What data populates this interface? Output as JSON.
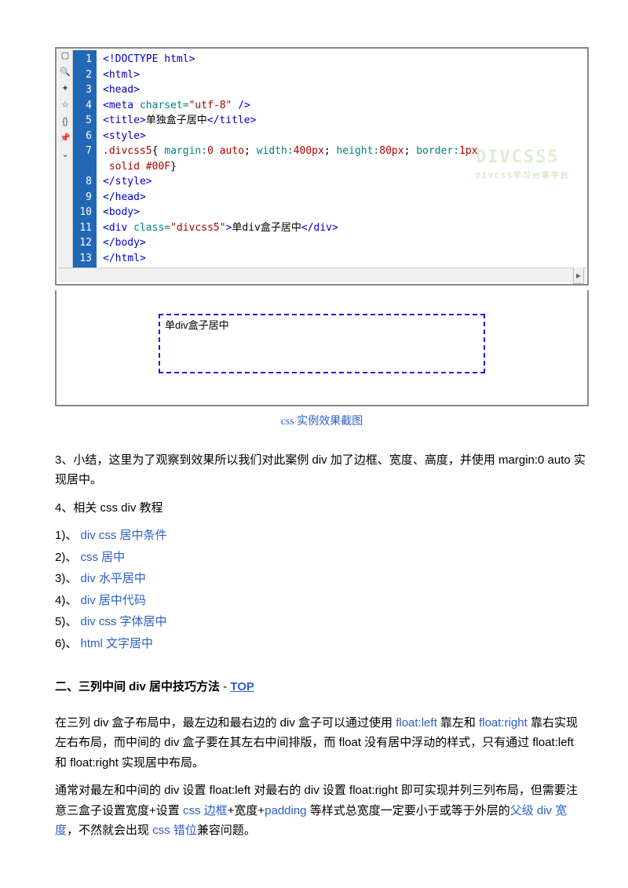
{
  "code": {
    "lines": [
      {
        "n": "1",
        "tag": "<!DOCTYPE html>"
      },
      {
        "n": "2",
        "tag": "<html>"
      },
      {
        "n": "3",
        "tag": "<head>"
      },
      {
        "n": "4",
        "raw": "<span class='tag'>&lt;meta</span> <span class='attr'>charset=</span><span class='str'>\"utf-8\"</span> <span class='tag'>/&gt;</span>"
      },
      {
        "n": "5",
        "raw": "<span class='tag'>&lt;title&gt;</span><span class='txt'>单独盒子居中</span><span class='tag'>&lt;/title&gt;</span>"
      },
      {
        "n": "6",
        "tag": "<style>"
      },
      {
        "n": "7",
        "raw": "<span class='sel'>.divcss5</span><span class='txt'>{</span> <span class='prop'>margin:</span><span class='val'>0 auto</span><span class='txt'>;</span> <span class='prop'>width:</span><span class='val'>400px</span><span class='txt'>;</span> <span class='prop'>height:</span><span class='val'>80px</span><span class='txt'>;</span> <span class='prop'>border:</span><span class='val'>1px</span>"
      },
      {
        "n": "",
        "raw": "&nbsp;<span class='val'>solid #00F</span><span class='txt'>}</span>"
      },
      {
        "n": "8",
        "tag": "</style>"
      },
      {
        "n": "9",
        "tag": "</head>"
      },
      {
        "n": "10",
        "tag": "<body>"
      },
      {
        "n": "11",
        "raw": "<span class='tag'>&lt;div</span> <span class='attr'>class=</span><span class='str'>\"divcss5\"</span><span class='tag'>&gt;</span><span class='txt'>单div盒子居中</span><span class='tag'>&lt;/div&gt;</span>"
      },
      {
        "n": "12",
        "tag": "</body>"
      },
      {
        "n": "13",
        "tag": "</html>"
      }
    ],
    "watermark": "DIVCSS5",
    "watermark_sub": "DIVCSS学习分享平台"
  },
  "preview_text": "单div盒子居中",
  "caption": "css 实例效果截图",
  "para3": "3、小结，这里为了观察到效果所以我们对此案例 div 加了边框、宽度、高度，并使用 margin:0 auto 实现居中。",
  "para4_head": "4、相关 css div 教程",
  "links": [
    {
      "num": "1)、",
      "text": "div css 居中条件"
    },
    {
      "num": "2)、",
      "text": "css 居中"
    },
    {
      "num": "3)、",
      "text": "div 水平居中"
    },
    {
      "num": "4)、",
      "text": "div 居中代码"
    },
    {
      "num": "5)、",
      "text": "div css 字体居中"
    },
    {
      "num": "6)、",
      "text": "html 文字居中"
    }
  ],
  "section2": {
    "title": "二、三列中间 div 居中技巧方法",
    "dash": "   -   ",
    "top": "TOP"
  },
  "para5": {
    "t1": "在三列 div 盒子布局中，最左边和最右边的 div 盒子可以通过使用 ",
    "l1": "float:left",
    "t2": " 靠左和 ",
    "l2": "float:right",
    "t3": " 靠右实现左右布局，而中间的 div 盒子要在其左右中间排版，而 float 没有居中浮动的样式，只有通过 float:left 和 float:right 实现居中布局。"
  },
  "para6": {
    "t1": "通常对最左和中间的 div 设置 float:left 对最右的 div 设置 float:right 即可实现并列三列布局，但需要注意三盒子设置宽度+设置 ",
    "l1": "css 边框",
    "t2": "+宽度+",
    "l2": "padding",
    "t3": " 等样式总宽度一定要小于或等于外层的",
    "l3": "父级 div 宽度",
    "t4": "，不然就会出现 ",
    "l4": "css 错位",
    "t5": "兼容问题。"
  }
}
